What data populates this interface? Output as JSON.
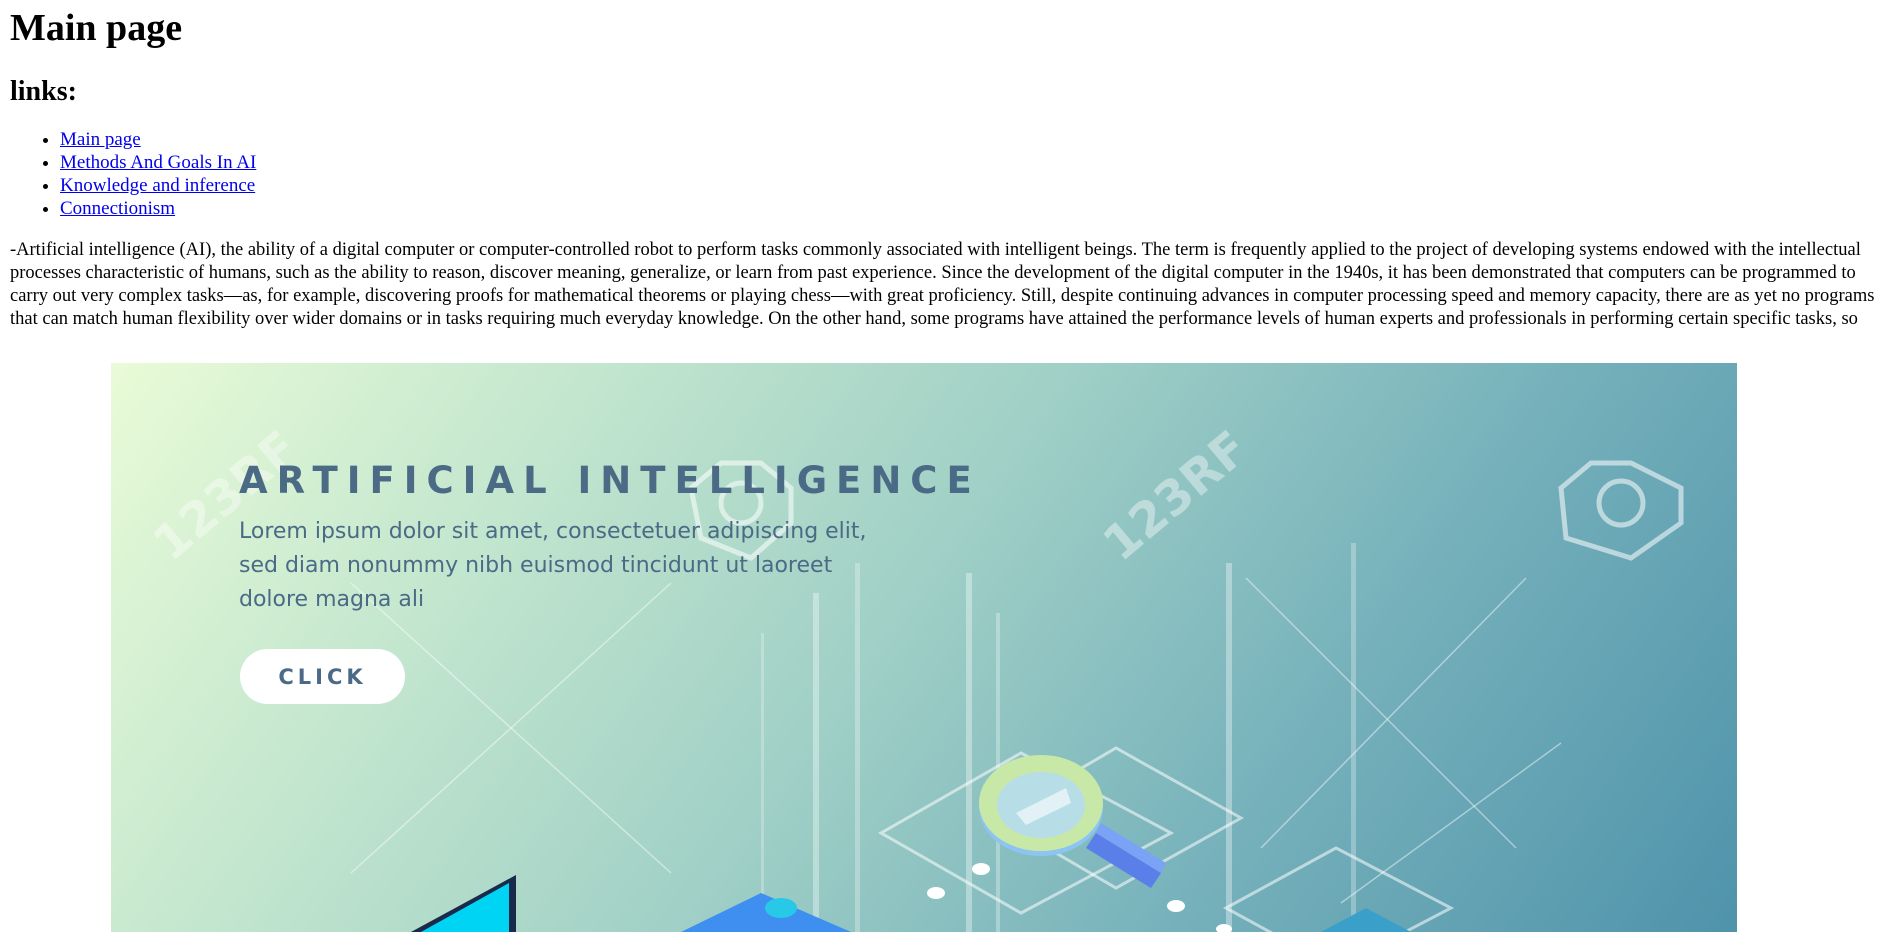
{
  "page": {
    "title": "Main page",
    "links_heading": "links:"
  },
  "links": [
    {
      "label": "Main page"
    },
    {
      "label": "Methods And Goals In AI"
    },
    {
      "label": "Knowledge and inference"
    },
    {
      "label": "Connectionism"
    }
  ],
  "intro_text": "-Artificial intelligence (AI), the ability of a digital computer or computer-controlled robot to perform tasks commonly associated with intelligent beings. The term is frequently applied to the project of developing systems endowed with the intellectual processes characteristic of humans, such as the ability to reason, discover meaning, generalize, or learn from past experience. Since the development of the digital computer in the 1940s, it has been demonstrated that computers can be programmed to carry out very complex tasks—as, for example, discovering proofs for mathematical theorems or playing chess—with great proficiency. Still, despite continuing advances in computer processing speed and memory capacity, there are as yet no programs that can match human flexibility over wider domains or in tasks requiring much everyday knowledge. On the other hand, some programs have attained the performance levels of human experts and professionals in performing certain specific tasks, so that artificial intelligence in this limited sense is found in applications as diverse as medical diagnosis, computer search engines, and voice or handwriting",
  "banner": {
    "title": "ARTIFICIAL INTELLIGENCE",
    "subtitle_lines": [
      "Lorem ipsum dolor sit amet, consectetuer adipiscing elit,",
      "sed diam nonummy nibh euismod tincidunt ut laoreet",
      "dolore magna ali"
    ],
    "button_label": "CLICK",
    "watermark": "123RF",
    "colors": {
      "gradient_start": "#e9fbd7",
      "gradient_end": "#4f93ab",
      "title_text": "#4a6a86",
      "magnifier": "#5b9cf0"
    },
    "icons": [
      "magnifying-glass-icon",
      "laptop-icon",
      "card-icon",
      "camera-watermark-icon"
    ]
  },
  "colors": {
    "link": "#0000ee",
    "text": "#000000",
    "background": "#ffffff"
  }
}
